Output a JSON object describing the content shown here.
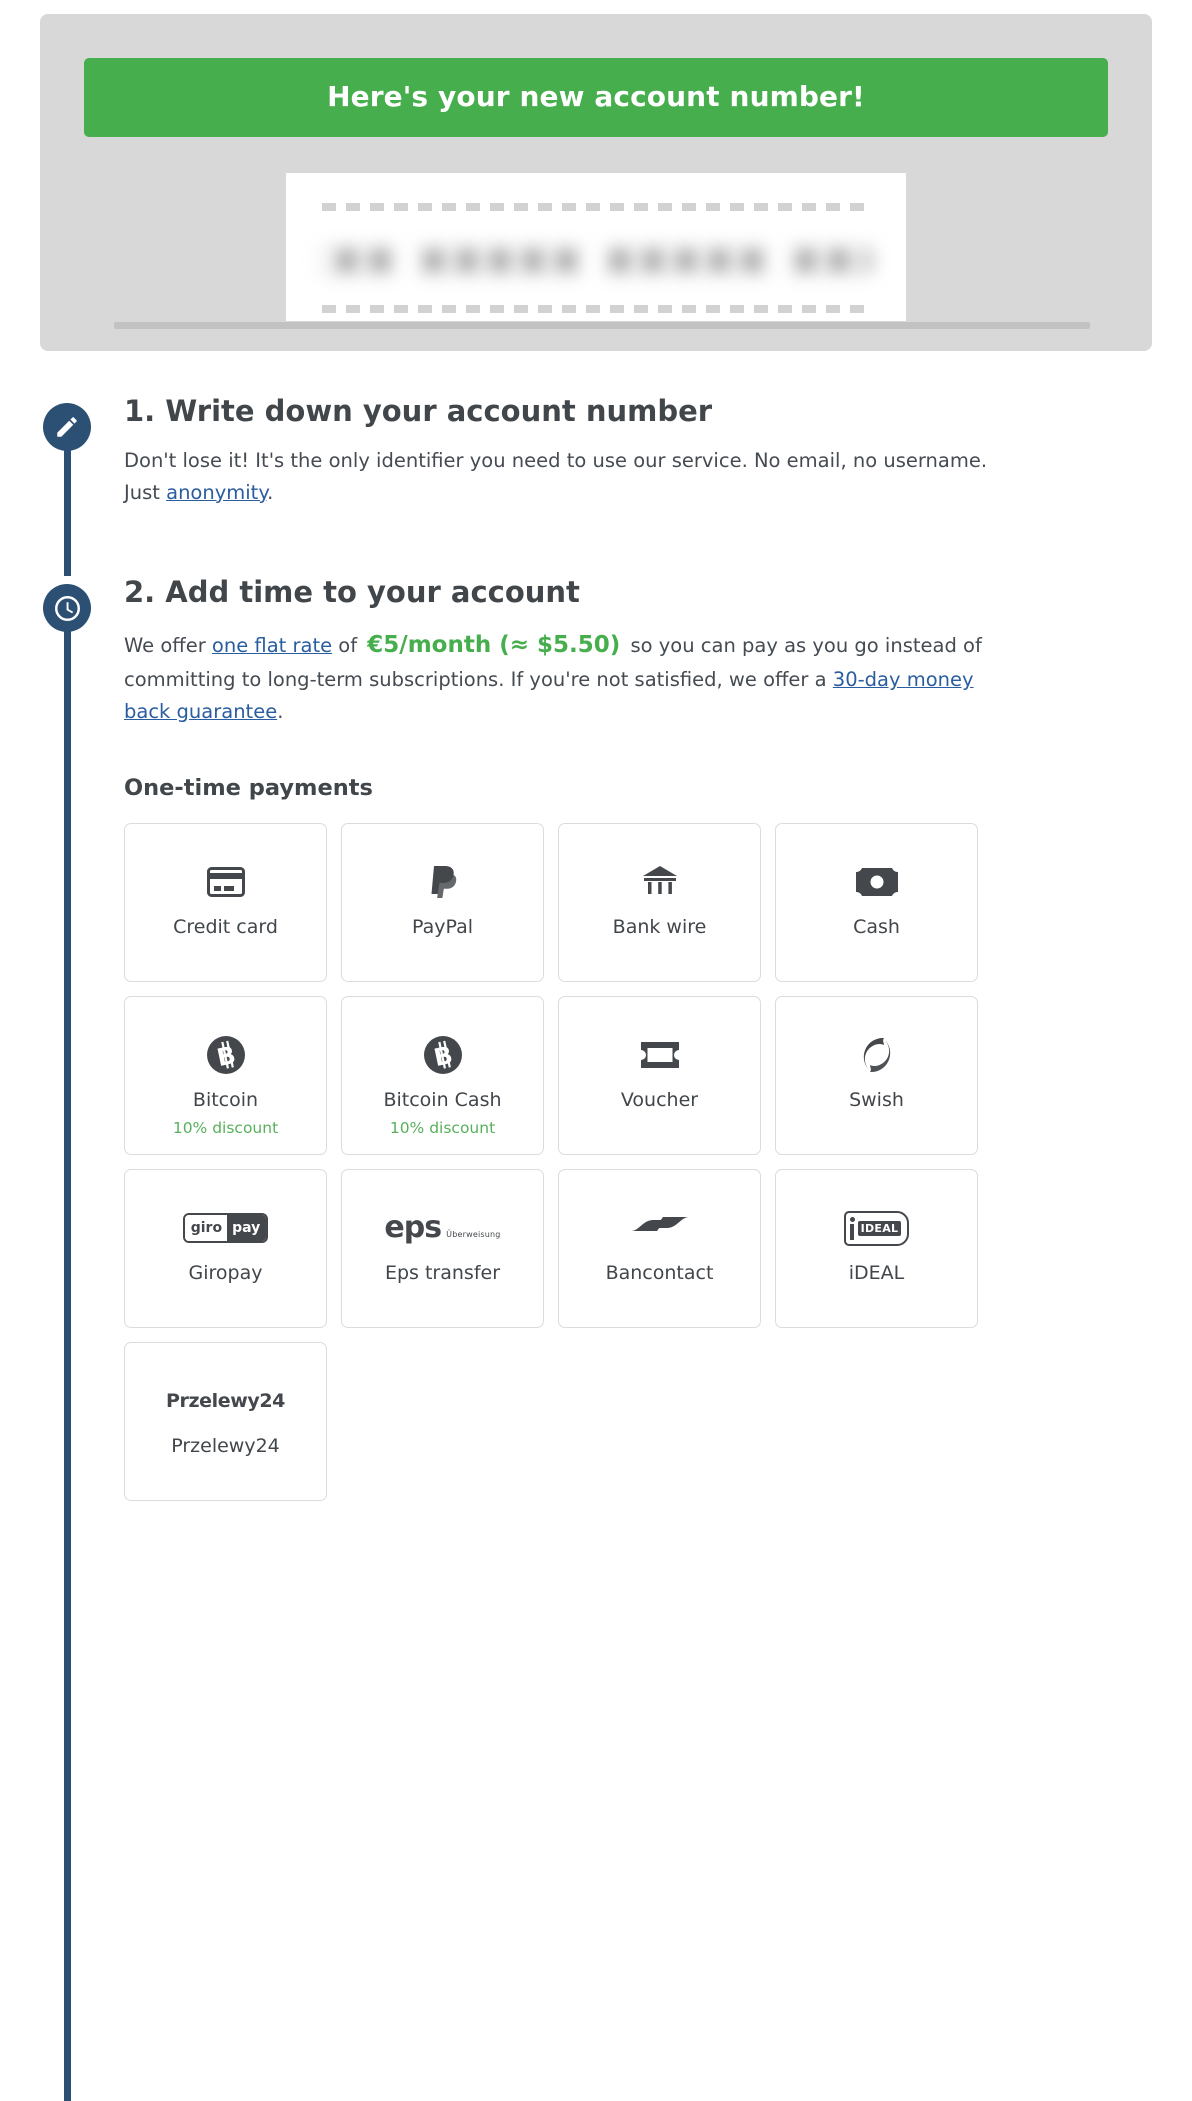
{
  "account_panel": {
    "banner_text": "Here's your new account number!",
    "banner_color": "#46ae4c",
    "account_number_redacted": "xxxxx xxxxx xxxxx xxxxx",
    "is_blurred": true
  },
  "steps": [
    {
      "icon": "pencil-icon",
      "title": "1. Write down your account number",
      "body_before_link": "Don't lose it! It's the only identifier you need to use our service. No email, no username. Just ",
      "link_text": "anonymity",
      "body_after_link": "."
    },
    {
      "icon": "clock-icon",
      "title": "2. Add time to your account",
      "body_part1": "We offer ",
      "link1_text": "one flat rate",
      "body_part2": " of ",
      "price_text": "€5/month (≈ $5.50)",
      "body_part3": " so you can pay as you go instead of committing to long-term subscriptions. If you're not satisfied, we offer a ",
      "link2_text": "30-day money back guarantee",
      "body_part4": "."
    }
  ],
  "payments": {
    "heading": "One-time payments",
    "discount_color": "#58b05c",
    "methods": [
      {
        "label": "Credit card",
        "icon": "credit-card-icon",
        "discount": ""
      },
      {
        "label": "PayPal",
        "icon": "paypal-icon",
        "discount": ""
      },
      {
        "label": "Bank wire",
        "icon": "bank-icon",
        "discount": ""
      },
      {
        "label": "Cash",
        "icon": "banknote-icon",
        "discount": ""
      },
      {
        "label": "Bitcoin",
        "icon": "bitcoin-icon",
        "discount": "10% discount"
      },
      {
        "label": "Bitcoin Cash",
        "icon": "bitcoin-cash-icon",
        "discount": "10% discount"
      },
      {
        "label": "Voucher",
        "icon": "voucher-icon",
        "discount": ""
      },
      {
        "label": "Swish",
        "icon": "swish-icon",
        "discount": ""
      },
      {
        "label": "Giropay",
        "icon": "giropay-logo",
        "discount": ""
      },
      {
        "label": "Eps transfer",
        "icon": "eps-logo",
        "discount": ""
      },
      {
        "label": "Bancontact",
        "icon": "bancontact-logo",
        "discount": ""
      },
      {
        "label": "iDEAL",
        "icon": "ideal-logo",
        "discount": ""
      },
      {
        "label": "Przelewy24",
        "icon": "przelewy24-logo",
        "discount": ""
      }
    ],
    "giropay_logo": {
      "part1": "giro",
      "part2": "pay"
    },
    "eps_logo": {
      "main": "eps",
      "sub": "Überweisung"
    },
    "ideal_logo": {
      "text": "IDEAL"
    },
    "przelewy_logo": {
      "text": "Przelewy24"
    }
  }
}
